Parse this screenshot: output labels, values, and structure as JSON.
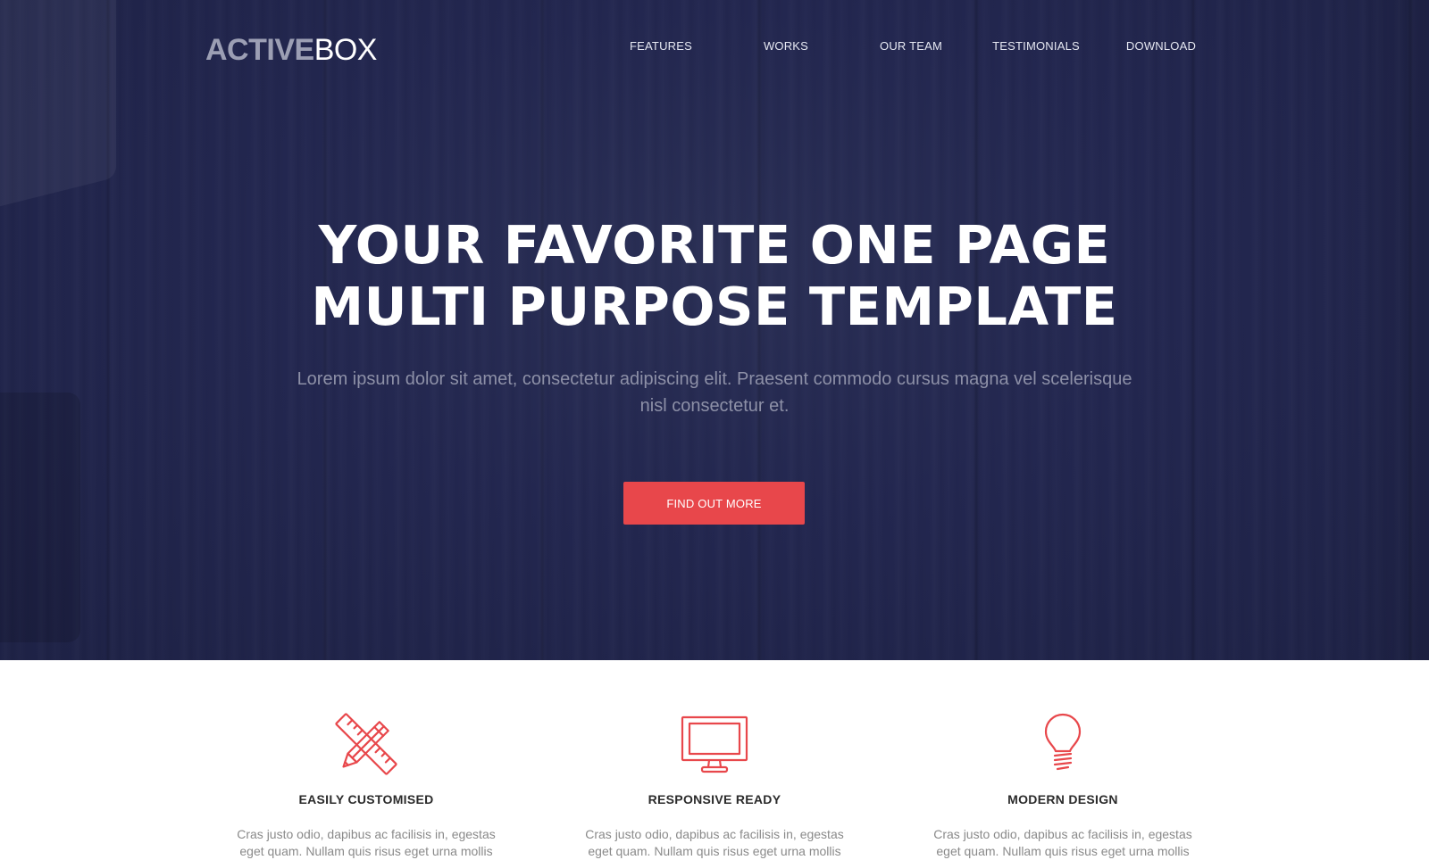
{
  "logo": {
    "strong": "ACTIVE",
    "light": "BOX"
  },
  "nav": {
    "items": [
      "FEATURES",
      "WORKS",
      "OUR TEAM",
      "TESTIMONIALS",
      "DOWNLOAD"
    ]
  },
  "hero": {
    "title_line1": "YOUR FAVORITE ONE PAGE",
    "title_line2": "MULTI PURPOSE TEMPLATE",
    "subtitle": "Lorem ipsum dolor sit amet, consectetur adipiscing elit. Praesent commodo cursus magna vel scelerisque nisl consectetur et.",
    "cta_label": "FIND OUT MORE"
  },
  "features": [
    {
      "icon": "pencil-ruler-icon",
      "title": "EASILY CUSTOMISED",
      "desc": "Cras justo odio, dapibus ac facilisis in, egestas eget quam. Nullam quis risus eget urna mollis"
    },
    {
      "icon": "monitor-icon",
      "title": "RESPONSIVE READY",
      "desc": "Cras justo odio, dapibus ac facilisis in, egestas eget quam. Nullam quis risus eget urna mollis"
    },
    {
      "icon": "lightbulb-icon",
      "title": "MODERN DESIGN",
      "desc": "Cras justo odio, dapibus ac facilisis in, egestas eget quam. Nullam quis risus eget urna mollis"
    }
  ],
  "colors": {
    "hero_bg": "#232750",
    "accent": "#e8474b",
    "nav_text": "#e6e8f2",
    "subtitle_text": "#8d90a7",
    "logo_strong": "#9c9fb4"
  }
}
